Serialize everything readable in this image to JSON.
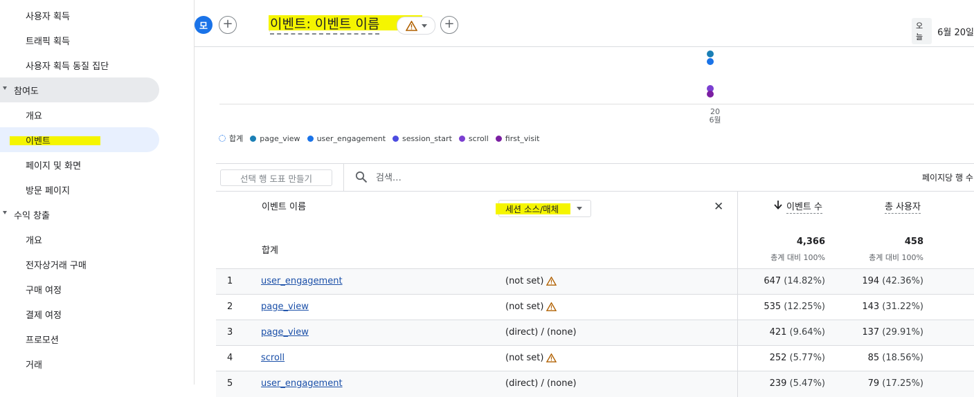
{
  "sidebar": {
    "items": [
      {
        "label": "사용자 획득",
        "kind": "sub"
      },
      {
        "label": "트래픽 획득",
        "kind": "sub"
      },
      {
        "label": "사용자 획득 동질 집단",
        "kind": "sub"
      },
      {
        "label": "참여도",
        "kind": "section"
      },
      {
        "label": "개요",
        "kind": "sub"
      },
      {
        "label": "이벤트",
        "kind": "sub"
      },
      {
        "label": "페이지 및 화면",
        "kind": "sub"
      },
      {
        "label": "방문 페이지",
        "kind": "sub"
      },
      {
        "label": "수익 창출",
        "kind": "section"
      },
      {
        "label": "개요",
        "kind": "sub"
      },
      {
        "label": "전자상거래 구매",
        "kind": "sub"
      },
      {
        "label": "구매 여정",
        "kind": "sub"
      },
      {
        "label": "결제 여정",
        "kind": "sub"
      },
      {
        "label": "프로모션",
        "kind": "sub"
      },
      {
        "label": "거래",
        "kind": "sub"
      }
    ]
  },
  "header": {
    "avatar": "모",
    "add_label": "+",
    "title": "이벤트: 이벤트 이름",
    "today": "오늘",
    "date_range": "6월 20일"
  },
  "chart": {
    "x_tick_day": "20",
    "x_tick_month": "6월"
  },
  "legend": {
    "total": "합계",
    "series": [
      {
        "name": "page_view",
        "color": "#1a7fb5"
      },
      {
        "name": "user_engagement",
        "color": "#1a73e8"
      },
      {
        "name": "session_start",
        "color": "#4c4ce0"
      },
      {
        "name": "scroll",
        "color": "#7b3fd1"
      },
      {
        "name": "first_visit",
        "color": "#7b1fa2"
      }
    ]
  },
  "toolbar": {
    "plot_rows": "선택 행 도표 만들기",
    "search_placeholder": "검색…",
    "rows_per_page": "페이지당 행 수"
  },
  "table": {
    "col_event_name": "이벤트 이름",
    "dimension": "세션 소스/매체",
    "col_event_count": "이벤트 수",
    "col_total_users": "총 사용자",
    "total_label": "합계",
    "total_event_count": "4,366",
    "total_users": "458",
    "total_sub": "총계 대비 100%",
    "rows": [
      {
        "num": "1",
        "event": "user_engagement",
        "source": "(not set)",
        "warn": true,
        "count": "647",
        "count_pct": "(14.82%)",
        "users": "194",
        "users_pct": "(42.36%)"
      },
      {
        "num": "2",
        "event": "page_view",
        "source": "(not set)",
        "warn": true,
        "count": "535",
        "count_pct": "(12.25%)",
        "users": "143",
        "users_pct": "(31.22%)"
      },
      {
        "num": "3",
        "event": "page_view",
        "source": "(direct) / (none)",
        "warn": false,
        "count": "421",
        "count_pct": "(9.64%)",
        "users": "137",
        "users_pct": "(29.91%)"
      },
      {
        "num": "4",
        "event": "scroll",
        "source": "(not set)",
        "warn": true,
        "count": "252",
        "count_pct": "(5.77%)",
        "users": "85",
        "users_pct": "(18.56%)"
      },
      {
        "num": "5",
        "event": "user_engagement",
        "source": "(direct) / (none)",
        "warn": false,
        "count": "239",
        "count_pct": "(5.47%)",
        "users": "79",
        "users_pct": "(17.25%)"
      }
    ]
  },
  "colors": {
    "accent": "#1a73e8",
    "highlight": "#f5f500",
    "warning": "#b06000",
    "link": "#1a4fa8"
  }
}
